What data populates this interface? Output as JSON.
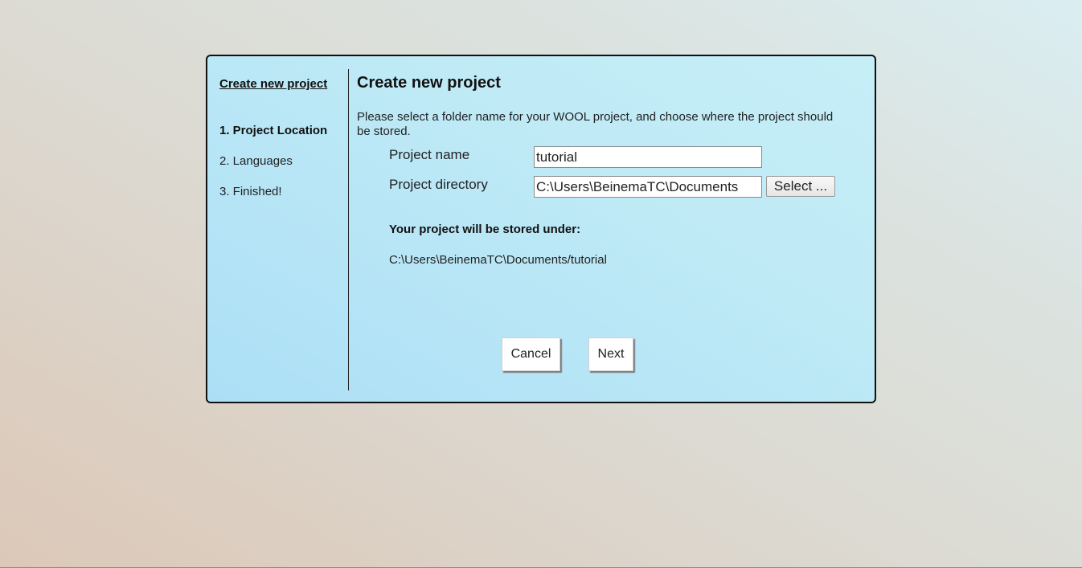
{
  "sidebar": {
    "title": "Create new project",
    "steps": [
      {
        "label": "1. Project Location",
        "active": true
      },
      {
        "label": "2. Languages",
        "active": false
      },
      {
        "label": "3. Finished!",
        "active": false
      }
    ]
  },
  "main": {
    "title": "Create new project",
    "intro": "Please select a folder name for your WOOL project, and choose where the project should be stored.",
    "project_name": {
      "label": "Project name",
      "value": "tutorial"
    },
    "project_directory": {
      "label": "Project directory",
      "value": "C:\\Users\\BeinemaTC\\Documents",
      "select_label": "Select ..."
    },
    "stored_under": {
      "heading": "Your project will be stored under:",
      "path": "C:\\Users\\BeinemaTC\\Documents/tutorial"
    },
    "buttons": {
      "cancel": "Cancel",
      "next": "Next"
    }
  },
  "colors": {
    "dialog_background": "#bde9f6",
    "dialog_border": "#111111",
    "button_background": "#ffffff"
  }
}
